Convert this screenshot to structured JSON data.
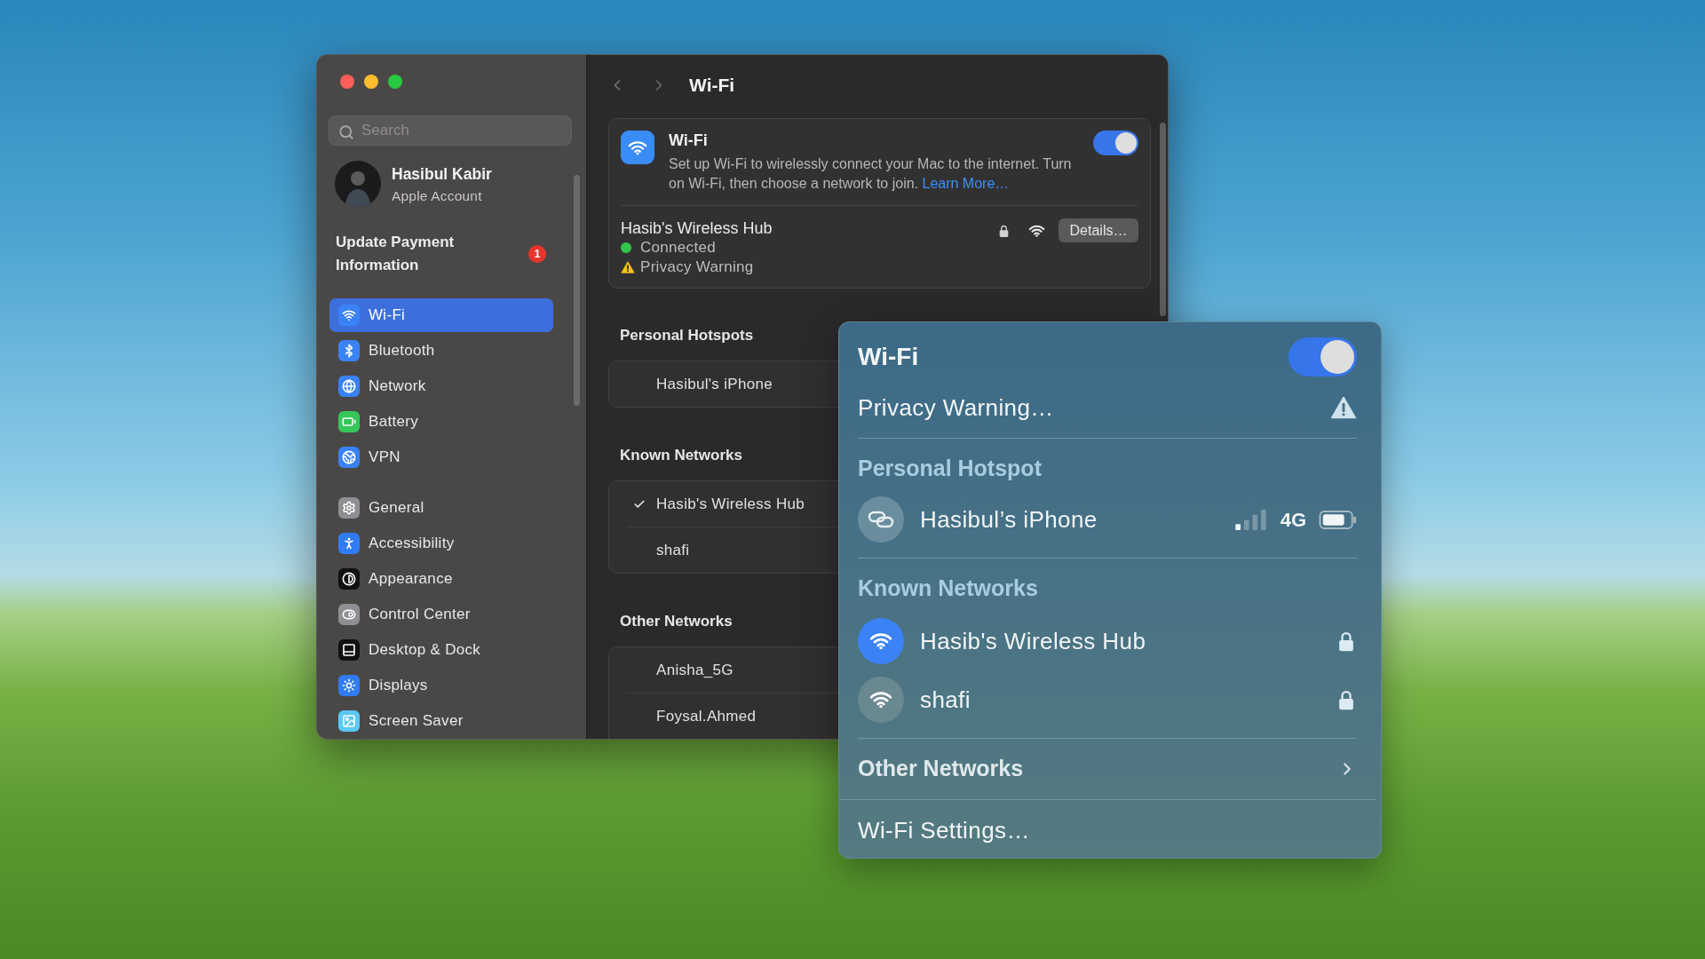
{
  "window": {
    "traffic_lights": [
      {
        "color": "#ff5f57"
      },
      {
        "color": "#febc2e"
      },
      {
        "color": "#28c840"
      }
    ]
  },
  "sidebar": {
    "search": {
      "placeholder": "Search"
    },
    "account": {
      "name": "Hasibul Kabir",
      "subtitle": "Apple Account"
    },
    "notice": {
      "text": "Update Payment Information",
      "badge": "1"
    },
    "groups": [
      {
        "items": [
          {
            "label": "Wi-Fi",
            "selected": true
          },
          {
            "label": "Bluetooth",
            "selected": false
          },
          {
            "label": "Network",
            "selected": false
          },
          {
            "label": "Battery",
            "selected": false
          },
          {
            "label": "VPN",
            "selected": false
          }
        ]
      },
      {
        "items": [
          {
            "label": "General",
            "selected": false
          },
          {
            "label": "Accessibility",
            "selected": false
          },
          {
            "label": "Appearance",
            "selected": false
          },
          {
            "label": "Control Center",
            "selected": false
          },
          {
            "label": "Desktop & Dock",
            "selected": false
          },
          {
            "label": "Displays",
            "selected": false
          },
          {
            "label": "Screen Saver",
            "selected": false
          }
        ]
      }
    ]
  },
  "toolbar": {
    "title": "Wi-Fi"
  },
  "wifi_card": {
    "title": "Wi-Fi",
    "description": "Set up Wi-Fi to wirelessly connect your Mac to the internet. Turn on Wi-Fi, then choose a network to join.",
    "link": "Learn More…",
    "on": true,
    "current_network": {
      "name": "Hasib's Wireless Hub",
      "status": "Connected",
      "warning": "Privacy Warning",
      "details_button": "Details…"
    }
  },
  "sections": [
    {
      "title": "Personal Hotspots",
      "networks": [
        {
          "name": "Hasibul's iPhone",
          "connected": false
        }
      ]
    },
    {
      "title": "Known Networks",
      "networks": [
        {
          "name": "Hasib's Wireless Hub",
          "connected": true
        },
        {
          "name": "shafi",
          "connected": false
        }
      ]
    },
    {
      "title": "Other Networks",
      "networks": [
        {
          "name": "Anisha_5G",
          "connected": false
        },
        {
          "name": "Foysal.Ahmed",
          "connected": false
        }
      ]
    }
  ],
  "menu": {
    "title": "Wi-Fi",
    "on": true,
    "privacy_warning": "Privacy Warning…",
    "hotspot_heading": "Personal Hotspot",
    "hotspots": [
      {
        "name": "Hasibul’s iPhone",
        "network_type": "4G"
      }
    ],
    "known_heading": "Known Networks",
    "known": [
      {
        "name": "Hasib's Wireless Hub",
        "connected": true
      },
      {
        "name": "shafi",
        "connected": false
      }
    ],
    "other_networks": "Other Networks",
    "settings": "Wi-Fi Settings…"
  }
}
